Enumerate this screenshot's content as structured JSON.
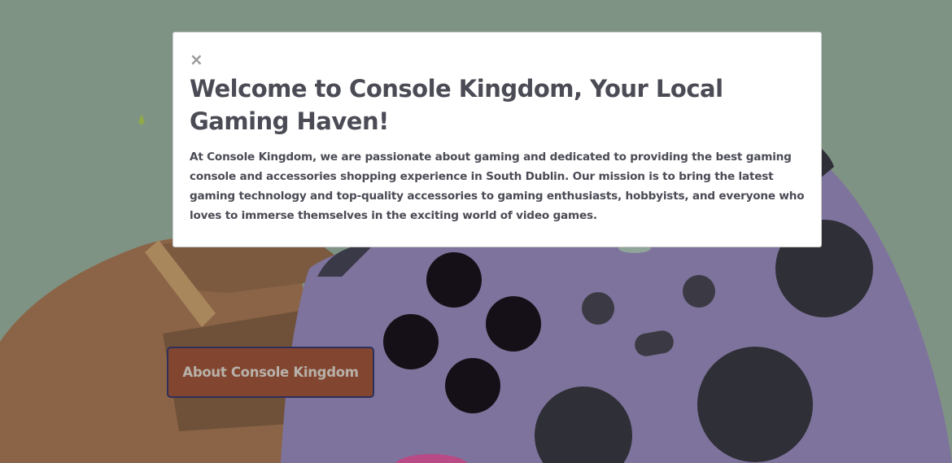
{
  "modal": {
    "close_label": "×",
    "title": "Welcome to Console Kingdom, Your Local Gaming Haven!",
    "description": "At Console Kingdom, we are passionate about gaming and dedicated to providing the best gaming console and accessories shopping experience in South Dublin. Our mission is to bring the latest gaming technology and top-quality accessories to gaming enthusiasts, hobbyists, and everyone who loves to immerse themselves in the exciting world of video games."
  },
  "hero": {
    "cta_label": "About Console Kingdom",
    "illustration": "hand-holding-game-controller"
  },
  "colors": {
    "background": "#7f9384",
    "controller": "#7e739c",
    "hand": "#8b6447",
    "button_fill": "#824630",
    "button_border": "#2f2f5c",
    "text_dark": "#4a4b55"
  }
}
